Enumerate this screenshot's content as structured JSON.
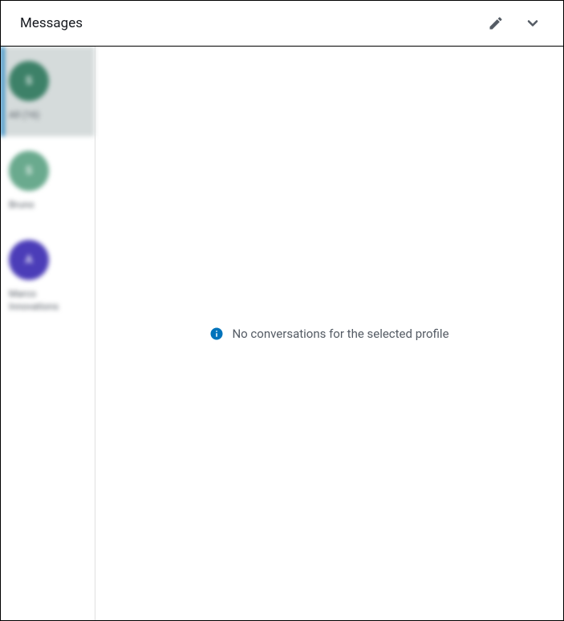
{
  "header": {
    "title": "Messages"
  },
  "sidebar": {
    "profiles": [
      {
        "label": "All (16)",
        "avatar_color": "green",
        "avatar_letter": "S",
        "selected": true
      },
      {
        "label": "Bruno",
        "avatar_color": "lightgreen",
        "avatar_letter": "S",
        "selected": false
      },
      {
        "label": "Marco Innovations",
        "avatar_color": "purple",
        "avatar_letter": "A",
        "selected": false
      }
    ]
  },
  "main": {
    "empty_message": "No conversations for the selected profile"
  }
}
